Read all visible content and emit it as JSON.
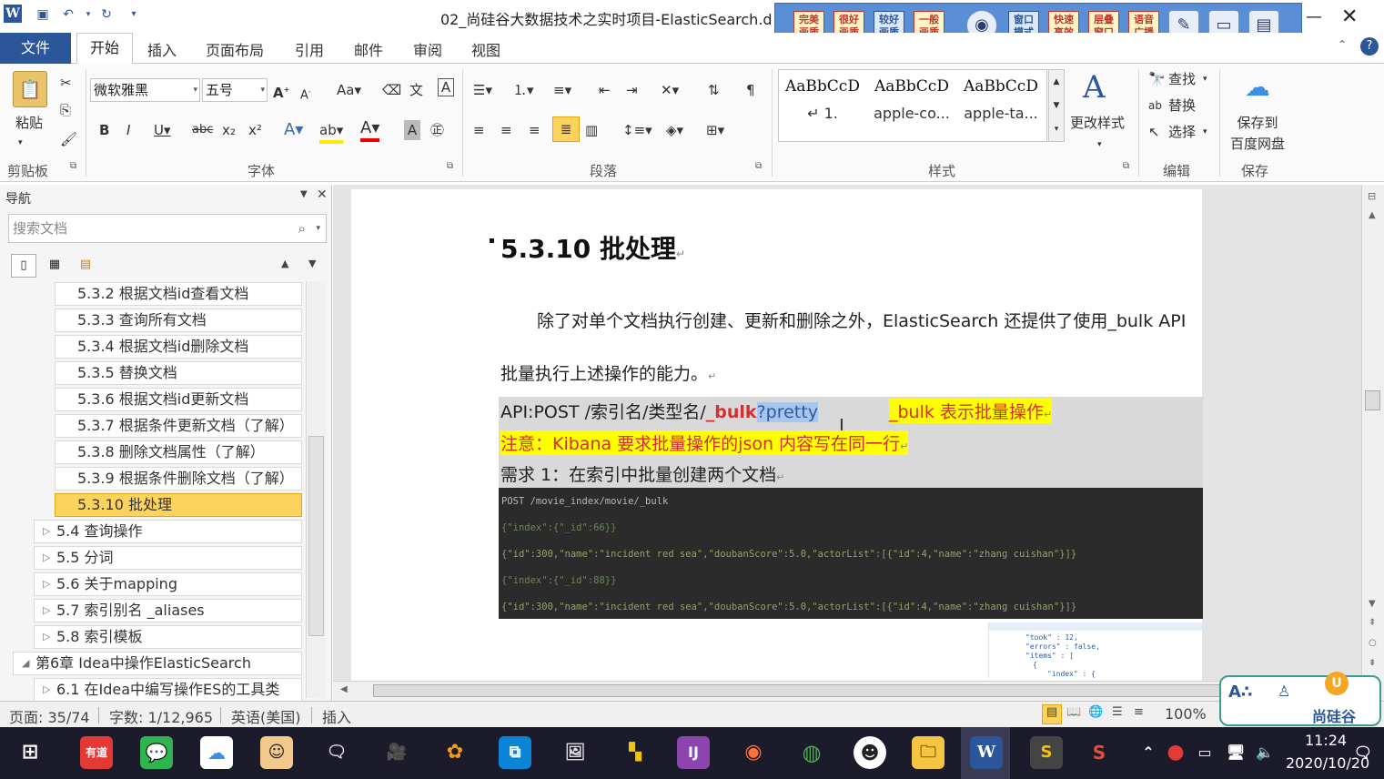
{
  "title_bar": {
    "doc_title": "02_尚硅谷大数据技术之实时项目-ElasticSearch.d",
    "plugin_buttons": [
      "完美画质",
      "很好画质",
      "较好画质",
      "一般画质",
      "窗口模式",
      "快速高效",
      "层叠窗口",
      "语音广播"
    ]
  },
  "ribbon_tabs": [
    "文件",
    "开始",
    "插入",
    "页面布局",
    "引用",
    "邮件",
    "审阅",
    "视图"
  ],
  "clipboard": {
    "paste": "粘贴",
    "group": "剪贴板"
  },
  "font": {
    "name": "微软雅黑",
    "size": "五号",
    "group": "字体"
  },
  "paragraph": {
    "group": "段落"
  },
  "styles": {
    "items": [
      {
        "sample": "AaBbCcD",
        "name": "↵ 1."
      },
      {
        "sample": "AaBbCcD",
        "name": "apple-co..."
      },
      {
        "sample": "AaBbCcD",
        "name": "apple-ta..."
      }
    ],
    "change": "更改样式",
    "group": "样式"
  },
  "editing": {
    "find": "查找",
    "replace": "替换",
    "select": "选择",
    "group": "编辑"
  },
  "save": {
    "label_line1": "保存到",
    "label_line2": "百度网盘",
    "group": "保存"
  },
  "nav": {
    "title": "导航",
    "search_placeholder": "搜索文档",
    "items": [
      {
        "label": "5.3.2 根据文档id查看文档",
        "level": 3
      },
      {
        "label": "5.3.3 查询所有文档",
        "level": 3
      },
      {
        "label": "5.3.4 根据文档id删除文档",
        "level": 3
      },
      {
        "label": "5.3.5 替换文档",
        "level": 3
      },
      {
        "label": "5.3.6 根据文档id更新文档",
        "level": 3
      },
      {
        "label": "5.3.7 根据条件更新文档（了解）",
        "level": 3
      },
      {
        "label": "5.3.8 删除文档属性（了解）",
        "level": 3
      },
      {
        "label": "5.3.9 根据条件删除文档（了解）",
        "level": 3
      },
      {
        "label": "5.3.10 批处理",
        "level": 3,
        "active": true
      },
      {
        "label": "5.4 查询操作",
        "level": 2
      },
      {
        "label": "5.5 分词",
        "level": 2
      },
      {
        "label": "5.6 关于mapping",
        "level": 2
      },
      {
        "label": "5.7 索引别名 _aliases",
        "level": 2
      },
      {
        "label": "5.8 索引模板",
        "level": 2
      },
      {
        "label": "第6章 Idea中操作ElasticSearch",
        "level": 1
      },
      {
        "label": "6.1 在Idea中编写操作ES的工具类",
        "level": 2
      }
    ]
  },
  "document": {
    "heading": "5.3.10   批处理",
    "para1_line1": "除了对单个文档执行创建、更新和删除之外，ElasticSearch  还提供了使用_bulk  API",
    "para1_line2": "批量执行上述操作的能力。",
    "api_prefix": "API:POST /索引名/类型名/",
    "api_bulk": "_bulk",
    "api_pretty": "?pretty",
    "api_note": "_bulk 表示批量操作",
    "kibana_note": "注意：Kibana 要求批量操作的json 内容写在同一行",
    "req": "需求 1：在索引中批量创建两个文档",
    "code": [
      "POST /movie_index/movie/_bulk",
      "{\"index\":{\"_id\":66}}",
      "{\"id\":300,\"name\":\"incident red sea\",\"doubanScore\":5.0,\"actorList\":[{\"id\":4,\"name\":\"zhang cuishan\"}]}",
      "{\"index\":{\"_id\":88}}",
      "{\"id\":300,\"name\":\"incident red sea\",\"doubanScore\":5.0,\"actorList\":[{\"id\":4,\"name\":\"zhang cuishan\"}]}"
    ],
    "result_lines": [
      "\"took\" : 12,",
      "\"errors\" : false,",
      "\"items\" : [",
      "{",
      "\"index\" : {"
    ]
  },
  "status_bar": {
    "page": "页面: 35/74",
    "words": "字数: 1/12,965",
    "lang": "英语(美国)",
    "mode": "插入",
    "zoom": "100%"
  },
  "taskbar": {
    "time": "11:24",
    "date": "2020/10/20"
  },
  "watermark": {
    "brand": "尚硅谷"
  },
  "colors": {
    "accent": "#2b579a",
    "nav_active": "#fcd35d",
    "code_bg": "#2b2b2b",
    "red_text": "#d32f2f",
    "yellow_hl": "#ffff00"
  }
}
